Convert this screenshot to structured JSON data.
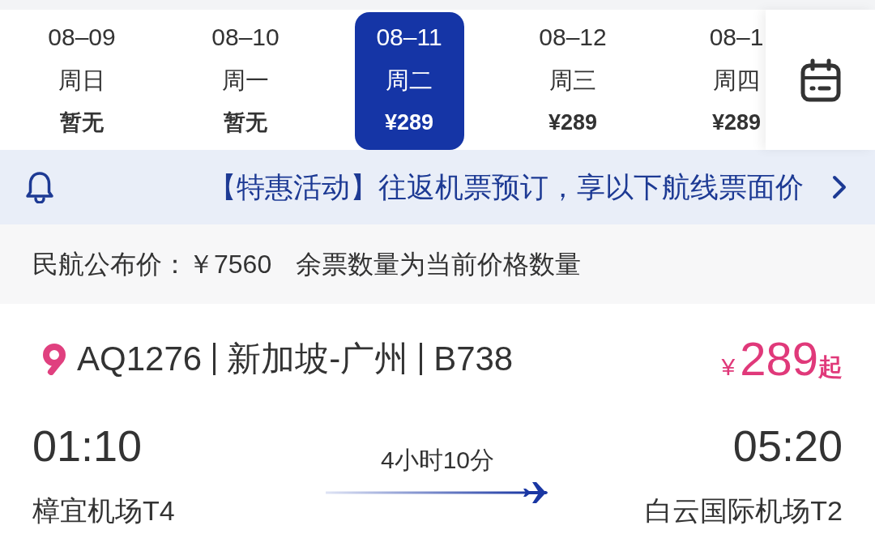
{
  "date_tabs": [
    {
      "date": "08–09",
      "weekday": "周日",
      "price": "暂无",
      "selected": false
    },
    {
      "date": "08–10",
      "weekday": "周一",
      "price": "暂无",
      "selected": false
    },
    {
      "date": "08–11",
      "weekday": "周二",
      "price": "¥289",
      "selected": true
    },
    {
      "date": "08–12",
      "weekday": "周三",
      "price": "¥289",
      "selected": false
    },
    {
      "date": "08–1",
      "weekday": "周四",
      "price": "¥289",
      "selected": false
    }
  ],
  "notice": {
    "text": "【特惠活动】往返机票预订，享以下航线票面价"
  },
  "fare_info": {
    "published_price": "民航公布价：￥7560",
    "remaining_note": "余票数量为当前价格数量"
  },
  "flight": {
    "flight_number": "AQ1276",
    "route": "新加坡-广州",
    "aircraft": "B738",
    "price": {
      "currency": "¥",
      "amount": "289",
      "suffix": "起"
    },
    "departure": {
      "time": "01:10",
      "airport": "樟宜机场T4"
    },
    "duration": "4小时10分",
    "arrival": {
      "time": "05:20",
      "airport": "白云国际机场T2"
    }
  }
}
